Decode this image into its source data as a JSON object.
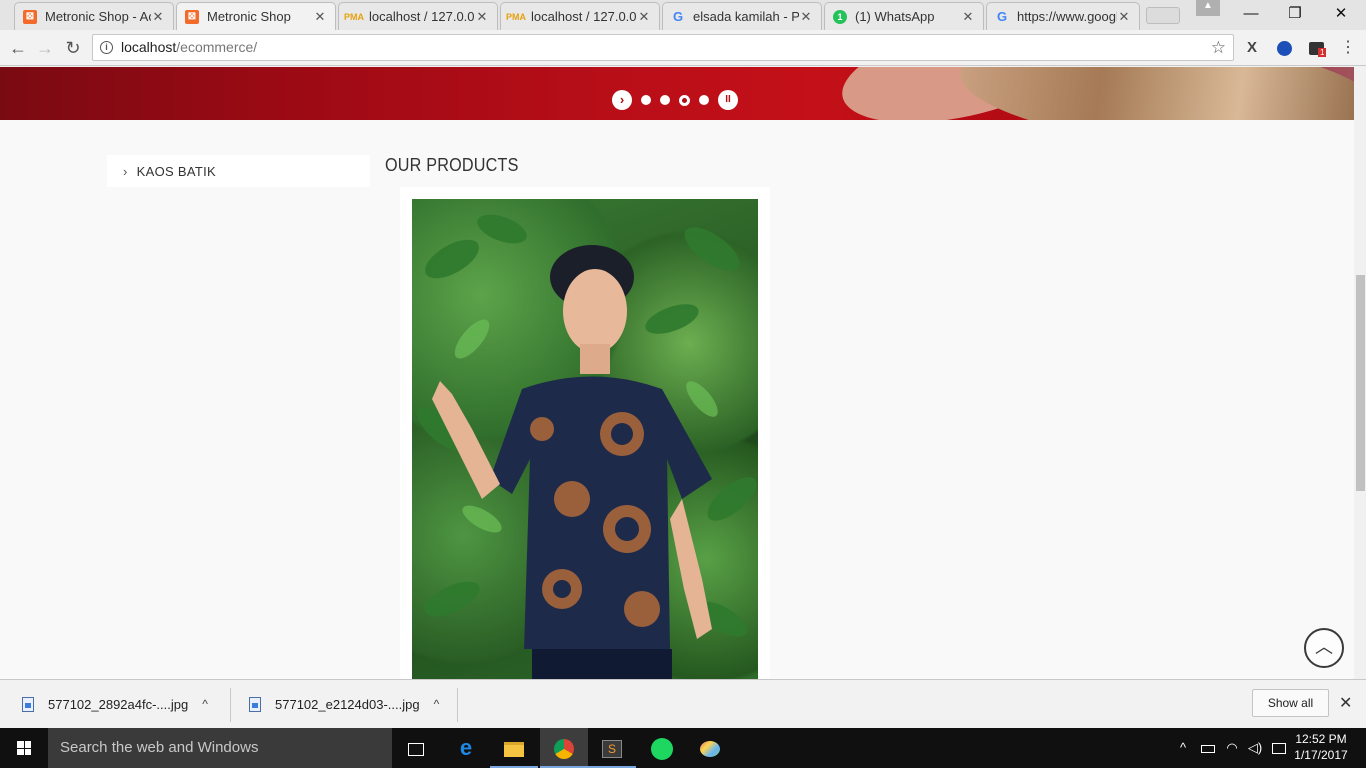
{
  "browser": {
    "tabs": [
      {
        "title": "Metronic Shop - Ac",
        "favicon": "xampp-icon",
        "active": false
      },
      {
        "title": "Metronic Shop",
        "favicon": "xampp-icon",
        "active": true
      },
      {
        "title": "localhost / 127.0.0.",
        "favicon": "phpmyadmin-icon",
        "active": false
      },
      {
        "title": "localhost / 127.0.0.",
        "favicon": "phpmyadmin-icon",
        "active": false
      },
      {
        "title": "elsada kamilah - Pe",
        "favicon": "google-icon",
        "active": false
      },
      {
        "title": "(1) WhatsApp",
        "favicon": "whatsapp-icon",
        "active": false
      },
      {
        "title": "https://www.googl",
        "favicon": "google-icon",
        "active": false
      }
    ],
    "url_host": "localhost",
    "url_path": "/ecommerce/",
    "icons": {
      "back": "←",
      "forward": "→",
      "reload": "↻",
      "star": "☆",
      "minimize": "—",
      "maximize": "❐",
      "close": "✕",
      "tab_close": "✕",
      "ext1": "X",
      "ext_badge": "1"
    }
  },
  "page": {
    "slider": {
      "dot_count": 4,
      "active_dot": 3,
      "next_icon": "›",
      "pause_icon": "II"
    },
    "sidebar": {
      "items": [
        {
          "label": "KAOS BATIK",
          "chevron": "›"
        }
      ]
    },
    "section_title": "OUR PRODUCTS",
    "back_to_top_icon": "︿"
  },
  "downloads": {
    "items": [
      {
        "filename": "577102_2892a4fc-....jpg"
      },
      {
        "filename": "577102_e2124d03-....jpg"
      }
    ],
    "caret": "^",
    "show_all": "Show all",
    "close": "✕"
  },
  "taskbar": {
    "search_placeholder": "Search the web and Windows",
    "time": "12:52 PM",
    "date": "1/17/2017",
    "tray_up": "^"
  },
  "colors": {
    "brand_red": "#b10f17",
    "taskbar": "#101010"
  }
}
